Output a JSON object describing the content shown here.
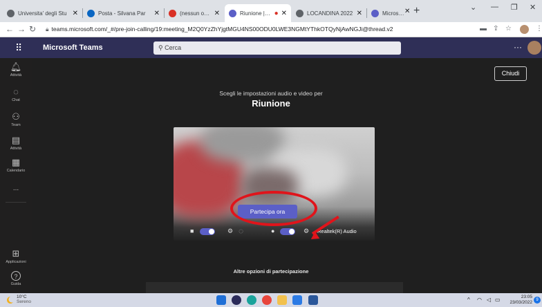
{
  "browser": {
    "tabs": [
      {
        "label": "Universita' degli Stu",
        "color": "#5f6368"
      },
      {
        "label": "Posta - Silvana Par",
        "color": "#0a66c2"
      },
      {
        "label": "(nessun oggetto) -",
        "color": "#d93025"
      },
      {
        "label": "Riunione | Mic",
        "color": "#5b5fc7"
      },
      {
        "label": "LOCANDINA 2022",
        "color": "#5f6368"
      },
      {
        "label": "Microsoft Teams",
        "color": "#5b5fc7"
      }
    ],
    "url": "teams.microsoft.com/_#/pre-join-calling/19:meeting_M2Q0YzZhYjgtMGU4NS00ODU0LWE3NGMtYThkOTQyNjAwNGJi@thread.v2"
  },
  "teams": {
    "app_title": "Microsoft Teams",
    "search_placeholder": "Cerca",
    "more": "···",
    "close_label": "Chiudi"
  },
  "rail": [
    {
      "label": "Attività",
      "icon": "bell-icon",
      "glyph": "🔔︎"
    },
    {
      "label": "Chat",
      "icon": "chat-icon",
      "glyph": "◌"
    },
    {
      "label": "Team",
      "icon": "teams-icon",
      "glyph": "⚇"
    },
    {
      "label": "Attività",
      "icon": "assignments-icon",
      "glyph": "▤"
    },
    {
      "label": "Calendario",
      "icon": "calendar-icon",
      "glyph": "▦"
    },
    {
      "label": "...",
      "icon": "more-apps-icon",
      "glyph": ""
    },
    {
      "label": "Applicazioni",
      "icon": "apps-icon",
      "glyph": "⊞"
    },
    {
      "label": "Guida",
      "icon": "help-icon",
      "glyph": "?"
    }
  ],
  "prejoin": {
    "subtitle": "Scegli le impostazioni audio e video per",
    "meeting_name": "Riunione",
    "join_label": "Partecipa ora",
    "audio_device": "Realtek(R) Audio",
    "other_options": "Altre opzioni di partecipazione"
  },
  "taskbar": {
    "temperature": "10°C",
    "weather": "Sereno",
    "time": "23:05",
    "date": "23/03/2022",
    "notifications": "9"
  }
}
